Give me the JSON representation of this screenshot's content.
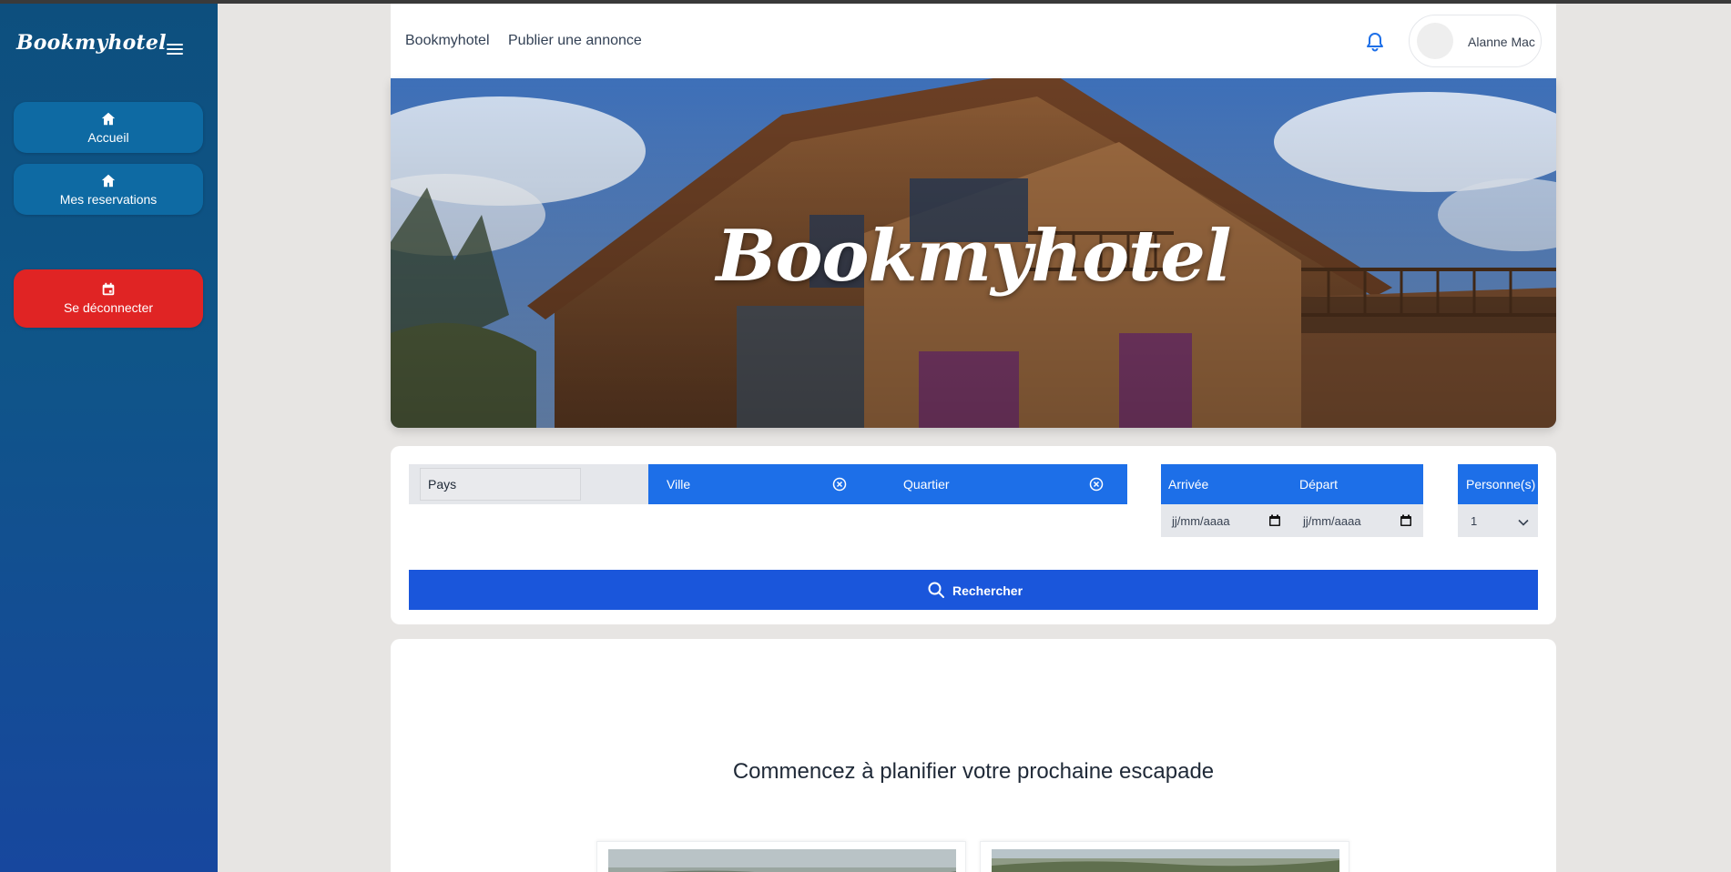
{
  "sidebar": {
    "brand": "Bookmyhotel",
    "items": [
      {
        "label": "Accueil",
        "icon": "home-icon"
      },
      {
        "label": "Mes reservations",
        "icon": "home-icon"
      }
    ],
    "logout": {
      "label": "Se déconnecter",
      "icon": "calendar-icon"
    }
  },
  "navbar": {
    "links": [
      "Bookmyhotel",
      "Publier une annonce"
    ],
    "user_name": "Alanne Mac"
  },
  "hero": {
    "title": "Bookmyhotel"
  },
  "search": {
    "country_placeholder": "Pays",
    "city_label": "Ville",
    "district_label": "Quartier",
    "arrival_label": "Arrivée",
    "departure_label": "Départ",
    "arrival_value": "jj/mm/aaaa",
    "departure_value": "jj/mm/aaaa",
    "persons_label": "Personne(s)",
    "persons_value": "1",
    "button_label": "Rechercher"
  },
  "lower": {
    "title": "Commencez à planifier votre prochaine escapade"
  },
  "colors": {
    "accent": "#1d6fe8",
    "button": "#1a56db",
    "logout": "#e02424",
    "sidebar": "#0d4f7e"
  }
}
